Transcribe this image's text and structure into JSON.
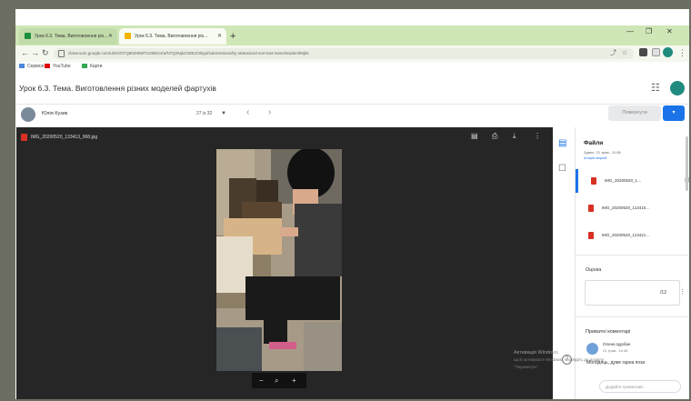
{
  "browser": {
    "tabs": [
      {
        "title": "Урок 6.3. Тема. Виготовлення різ…",
        "active": false,
        "favicon_color": "#1e8e3e"
      },
      {
        "title": "Урок 6.3. Тема. Виготовлення різ…",
        "active": true,
        "favicon_color": "#f4b400"
      }
    ],
    "url": "classroom.google.com/u/0/c/NTQ5NDI5MTU2MDc4/a/NTQ3NjkzODE2ODg4/submissions/by-status/and-sort-last-name/student/Mjk5",
    "bookmarks": [
      {
        "label": "Сервіси",
        "icon": "apps-icon",
        "color": "#4a89dc"
      },
      {
        "label": "YouTube",
        "icon": "youtube-icon",
        "color": "#e00000"
      },
      {
        "label": "Карти",
        "icon": "maps-icon",
        "color": "#34a853"
      }
    ]
  },
  "classroom": {
    "title": "Урок 6.3. Тема. Виготовлення різних моделей фартухів",
    "student_name": "Юлія Кузик",
    "student_count": "27 із 32",
    "return_label": "Повернути",
    "accent": "#1a73e8"
  },
  "viewer": {
    "filename": "IMG_20200520_133413_968.jpg",
    "zoom_minus": "−",
    "zoom_icon": "magnifier-icon",
    "zoom_plus": "+"
  },
  "panel": {
    "files_title": "Файли",
    "files_meta": "Здано: 21 трав., 11:08",
    "files_link": "Історія версій",
    "files": [
      "IMG_20200520_1…",
      "IMG_20200520_113415…",
      "IMG_20200520_113421…"
    ],
    "grade_label": "Оцінка",
    "grade_value": "/12",
    "private_comments_label": "Приватні коментарі",
    "commenter_name": "Олена Цурбан",
    "commenter_date": "21 трав., 14:49",
    "comment_text": "Молодець, дуже гарна поза",
    "comment_placeholder": "Додайте приватний…"
  },
  "watermark": {
    "line1": "Активація Windows",
    "line2": "Щоб активувати Windows, перейдіть до розділу",
    "line3": "\"Параметри\"."
  }
}
